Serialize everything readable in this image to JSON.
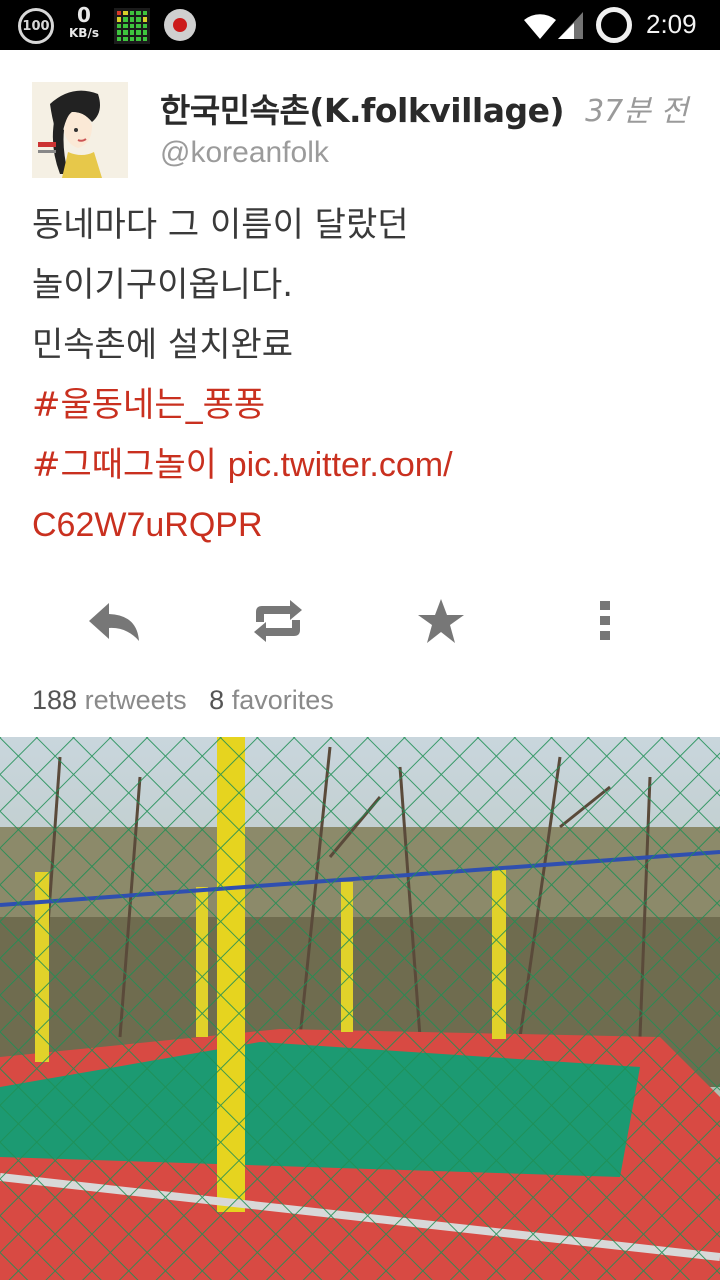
{
  "status_bar": {
    "battery_badge": "100",
    "network_speed_value": "0",
    "network_speed_unit": "KB/s",
    "time": "2:09",
    "icons": [
      "battery-badge-icon",
      "equalizer-icon",
      "record-icon",
      "wifi-icon",
      "cell-signal-icon",
      "sync-ring-icon"
    ]
  },
  "tweet": {
    "user_name": "한국민속촌(K.folkvillage)",
    "handle": "@koreanfolk",
    "timestamp": "37분 전",
    "text_lines": [
      "동네마다 그 이름이 달랐던",
      "놀이기구이옵니다.",
      "민속촌에 설치완료"
    ],
    "hashtag_1": "#울동네는_퐁퐁",
    "hashtag_2": "#그때그놀이",
    "link_part1": "pic.twitter.com/",
    "link_part2": "C62W7uRQPR",
    "link_color": "#c9301f"
  },
  "actions": {
    "icons": [
      "reply-icon",
      "retweet-icon",
      "favorite-star-icon",
      "more-vertical-icon"
    ]
  },
  "stats": {
    "retweets_count": "188",
    "retweets_label": "retweets",
    "favorites_count": "8",
    "favorites_label": "favorites"
  },
  "media": {
    "description_icon": "trampoline-photo"
  }
}
